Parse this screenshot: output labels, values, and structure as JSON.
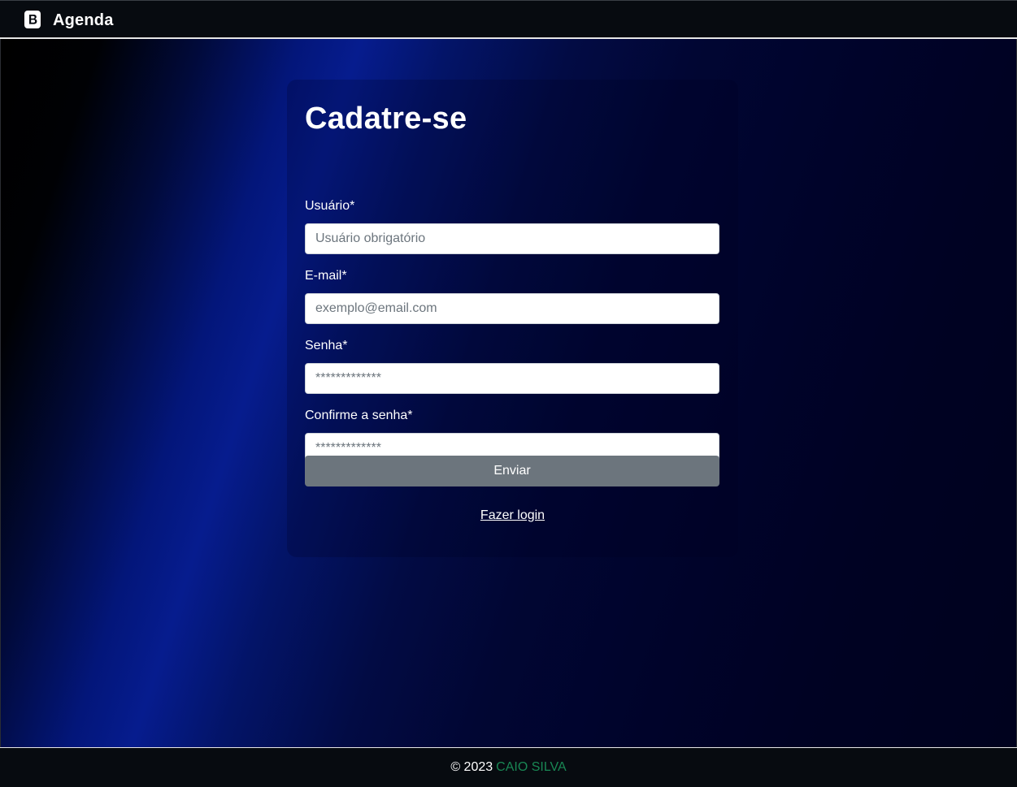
{
  "navbar": {
    "brand_icon": "bootstrap-logo-icon",
    "title": "Agenda"
  },
  "form": {
    "title": "Cadatre-se",
    "fields": [
      {
        "label": "Usuário*",
        "placeholder": "Usuário obrigatório",
        "value": ""
      },
      {
        "label": "E-mail*",
        "placeholder": "exemplo@email.com",
        "value": ""
      },
      {
        "label": "Senha*",
        "placeholder": "*************",
        "value": ""
      },
      {
        "label": "Confirme a senha*",
        "placeholder": "*************",
        "value": ""
      }
    ],
    "submit_label": "Enviar",
    "login_link": "Fazer login"
  },
  "footer": {
    "copyright": "© 2023",
    "author": "CAIO SILVA"
  },
  "colors": {
    "nav_bg": "#070b10",
    "gradient_blue": "#061c8e",
    "button_gray": "#6c757d",
    "author_green": "#198754"
  }
}
